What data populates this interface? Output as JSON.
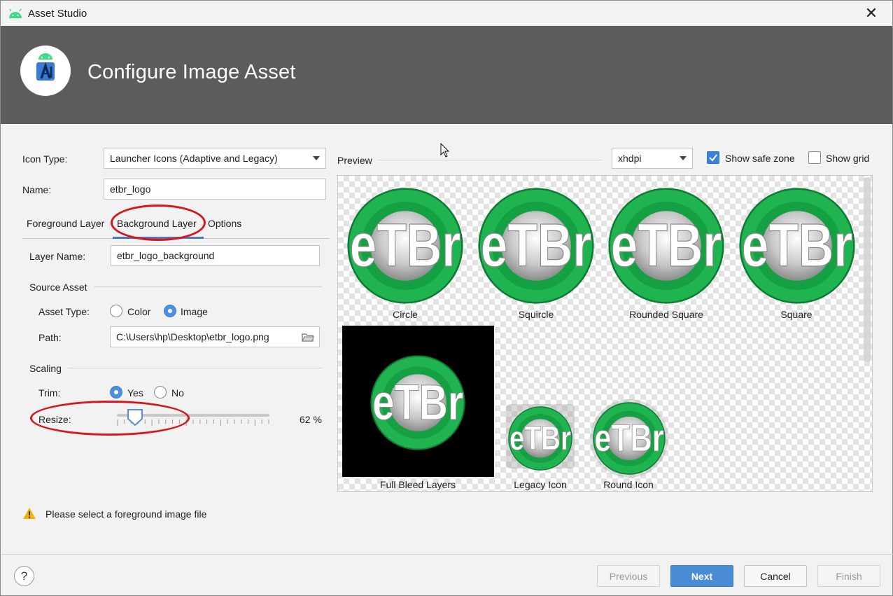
{
  "window": {
    "title": "Asset Studio",
    "close_glyph": "✕"
  },
  "banner": {
    "heading": "Configure Image Asset",
    "logo_icon": "android-studio-icon"
  },
  "form": {
    "icon_type_label": "Icon Type:",
    "icon_type_value": "Launcher Icons (Adaptive and Legacy)",
    "name_label": "Name:",
    "name_value": "etbr_logo"
  },
  "tabs": [
    {
      "label": "Foreground Layer",
      "selected": false
    },
    {
      "label": "Background Layer",
      "selected": true
    },
    {
      "label": "Options",
      "selected": false
    }
  ],
  "layer": {
    "layer_name_label": "Layer Name:",
    "layer_name_value": "etbr_logo_background",
    "source_asset_title": "Source Asset",
    "asset_type_label": "Asset Type:",
    "asset_type_options": [
      "Color",
      "Image"
    ],
    "asset_type_selected": "Image",
    "path_label": "Path:",
    "path_value": "C:\\Users\\hp\\Desktop\\etbr_logo.png",
    "scaling_title": "Scaling",
    "trim_label": "Trim:",
    "trim_options": [
      "Yes",
      "No"
    ],
    "trim_selected": "Yes",
    "resize_label": "Resize:",
    "resize_value": 62,
    "resize_text": "62 %"
  },
  "preview": {
    "title": "Preview",
    "density_value": "xhdpi",
    "show_safe_zone_label": "Show safe zone",
    "show_safe_zone_checked": true,
    "show_grid_label": "Show grid",
    "show_grid_checked": false,
    "logo_text": "eTBr",
    "icons": [
      {
        "label": "Circle"
      },
      {
        "label": "Squircle"
      },
      {
        "label": "Rounded Square"
      },
      {
        "label": "Square"
      },
      {
        "label": "Full Bleed Layers"
      },
      {
        "label": "Legacy Icon"
      },
      {
        "label": "Round Icon"
      }
    ]
  },
  "warning": {
    "text": "Please select a foreground image file"
  },
  "footer": {
    "help_glyph": "?",
    "previous_label": "Previous",
    "next_label": "Next",
    "cancel_label": "Cancel",
    "finish_label": "Finish"
  },
  "colors": {
    "accent": "#4a8bd6",
    "banner": "#5c5c5c",
    "logo_green": "#1fb450",
    "annotation_red": "#d9141c"
  }
}
